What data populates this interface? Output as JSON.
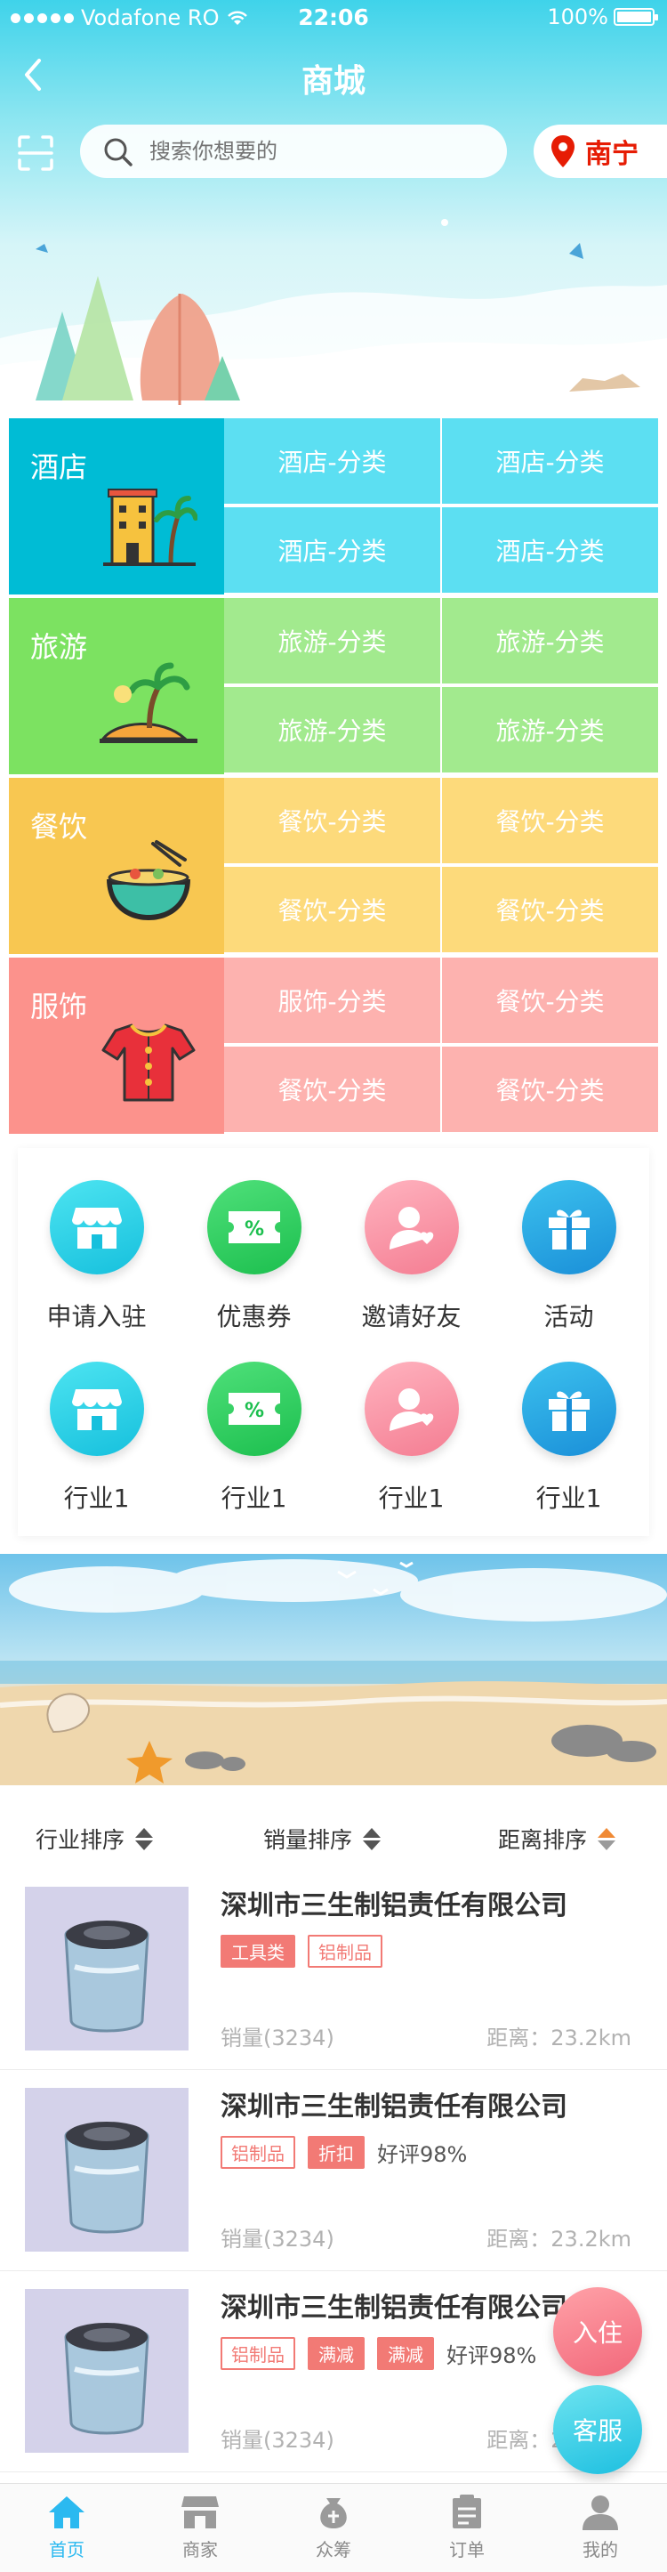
{
  "status_bar": {
    "carrier": "Vodafone RO",
    "time": "22:06",
    "battery": "100%"
  },
  "header": {
    "title": "商城",
    "search_placeholder": "搜索你想要的",
    "city": "南宁"
  },
  "categories": [
    {
      "name": "酒店",
      "color": "#00bcd5",
      "subs": [
        "酒店-分类",
        "酒店-分类",
        "酒店-分类",
        "酒店-分类"
      ],
      "sub_color": "#5cdff2"
    },
    {
      "name": "旅游",
      "color": "#7ce261",
      "subs": [
        "旅游-分类",
        "旅游-分类",
        "旅游-分类",
        "旅游-分类"
      ],
      "sub_color": "#a2ea8e"
    },
    {
      "name": "餐饮",
      "color": "#f8c751",
      "subs": [
        "餐饮-分类",
        "餐饮-分类",
        "餐饮-分类",
        "餐饮-分类"
      ],
      "sub_color": "#fdda7b"
    },
    {
      "name": "服饰",
      "color": "#fc928c",
      "subs": [
        "服饰-分类",
        "餐饮-分类",
        "餐饮-分类",
        "餐饮-分类"
      ],
      "sub_color": "#fdb2af"
    }
  ],
  "quick_entries": [
    {
      "label": "申请入驻",
      "icon": "shop-icon"
    },
    {
      "label": "优惠券",
      "icon": "coupon-icon"
    },
    {
      "label": "邀请好友",
      "icon": "invite-friend-icon"
    },
    {
      "label": "活动",
      "icon": "gift-icon"
    },
    {
      "label": "行业1",
      "icon": "shop-icon"
    },
    {
      "label": "行业1",
      "icon": "coupon-icon"
    },
    {
      "label": "行业1",
      "icon": "invite-friend-icon"
    },
    {
      "label": "行业1",
      "icon": "gift-icon"
    }
  ],
  "sort": {
    "industry": "行业排序",
    "sales": "销量排序",
    "distance": "距离排序"
  },
  "shops": [
    {
      "name": "深圳市三生制铝责任有限公司",
      "tags": [
        {
          "text": "工具类",
          "filled": true
        },
        {
          "text": "铝制品",
          "filled": false
        }
      ],
      "rating": "",
      "sales": "销量(3234)",
      "distance": "距离：23.2km"
    },
    {
      "name": "深圳市三生制铝责任有限公司",
      "tags": [
        {
          "text": "铝制品",
          "filled": false
        },
        {
          "text": "折扣",
          "filled": true
        }
      ],
      "rating": "好评98%",
      "sales": "销量(3234)",
      "distance": "距离：23.2km"
    },
    {
      "name": "深圳市三生制铝责任有限公司",
      "tags": [
        {
          "text": "铝制品",
          "filled": false
        },
        {
          "text": "满减",
          "filled": true
        },
        {
          "text": "满减",
          "filled": true
        }
      ],
      "rating": "好评98%",
      "sales": "销量(3234)",
      "distance": "距离：23.2km"
    }
  ],
  "floating": {
    "join": "入住",
    "service": "客服"
  },
  "tabs": [
    {
      "label": "首页",
      "icon": "home-icon",
      "active": true
    },
    {
      "label": "商家",
      "icon": "store-icon",
      "active": false
    },
    {
      "label": "众筹",
      "icon": "crowdfund-icon",
      "active": false
    },
    {
      "label": "订单",
      "icon": "order-icon",
      "active": false
    },
    {
      "label": "我的",
      "icon": "profile-icon",
      "active": false
    }
  ],
  "colors": {
    "accent": "#2bb9f0",
    "city": "#e61c04",
    "tag": "#f27a75",
    "muted": "#b2b2b2"
  }
}
